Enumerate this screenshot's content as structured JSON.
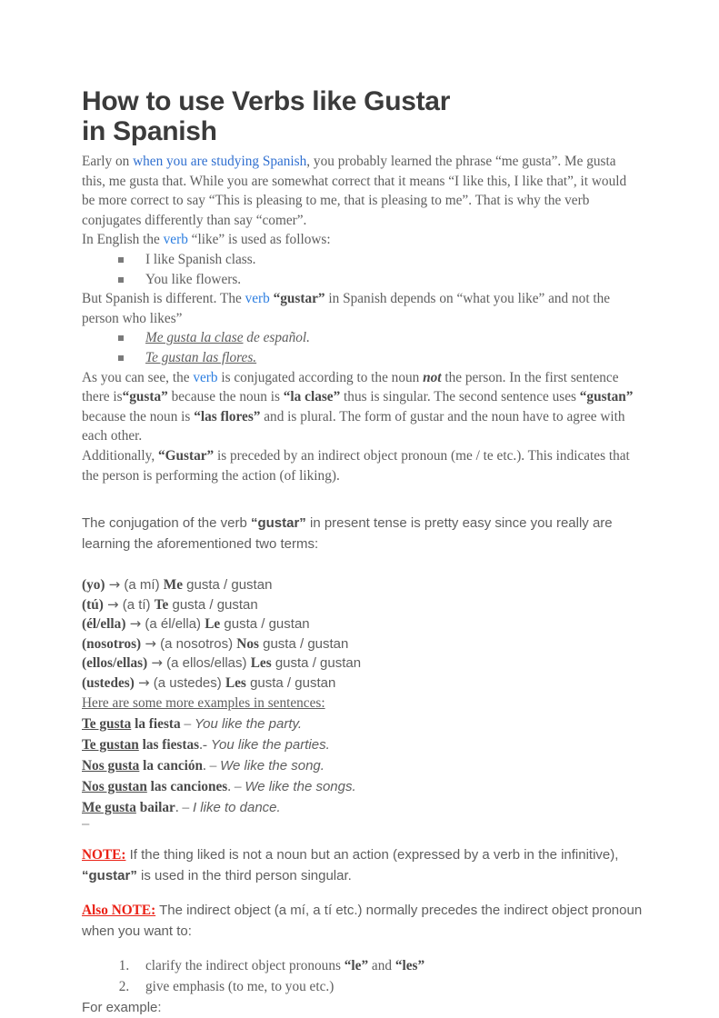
{
  "document": {
    "title_line_1": "How to use Verbs like Gustar",
    "title_line_2": "in Spanish"
  },
  "colors": {
    "link_blue": "#2f6fd0",
    "link_blue_bright": "#2b7de0",
    "note_red": "#ea2116",
    "body_text": "#5e5e5e",
    "heading_text": "#3b3b3b"
  },
  "intro": {
    "p1_a": "Early on ",
    "p1_link": "when you are studying Spanish",
    "p1_b": ", you probably learned the phrase “me gusta”.  Me gusta this, me gusta that. While you are somewhat correct that it means “I like this, I like that”, it would be more correct to say “This is pleasing to me, that is pleasing to me”.  That is why the verb conjugates differently than say “comer”.",
    "p2_a": "In English the ",
    "p2_link": "verb",
    "p2_b": " “like” is used as follows:"
  },
  "english_examples": [
    "I like Spanish class.",
    "You like flowers."
  ],
  "spanish_intro": {
    "a": "But Spanish is different. The ",
    "link": "verb",
    "b": " ",
    "bold": "“gustar”",
    "c": " in Spanish depends on “what you like” and not the person who likes”"
  },
  "spanish_examples": [
    {
      "underlined": "Me gusta la clase",
      "rest": " de español."
    },
    {
      "underlined": "Te gustan las flores.",
      "rest": ""
    }
  ],
  "explanation": {
    "a": "As you can see, the ",
    "link": "verb",
    "b": " is conjugated according to the noun ",
    "not": "not",
    "c": " the person.  In the first sentence there is",
    "gusta": "“gusta”",
    "d": " because the noun is ",
    "la_clase": "“la clase”",
    "e": " thus is singular.  The second sentence uses ",
    "gustan": "“gustan”",
    "f": " because the noun is ",
    "las_flores": "“las flores”",
    "g": " and is plural.  The form of gustar and the noun have to agree with each other.",
    "h": "Additionally, ",
    "gustar_cap": "“Gustar”",
    "i": " is preceded by an indirect object pronoun (me / te etc.). This indicates that the person is performing the action (of liking)."
  },
  "conjugation_intro": {
    "a": "The conjugation of the verb ",
    "bold": "“gustar”",
    "b": " in present tense is pretty easy since you really are learning the aforementioned two terms:"
  },
  "conjugation": [
    {
      "subject": "(yo)",
      "arrow": "→",
      "indirect": "(a mí)",
      "pronoun": "Me",
      "forms": "gusta / gustan"
    },
    {
      "subject": "(tú)",
      "arrow": "→",
      "indirect": "(a tí)",
      "pronoun": "Te",
      "forms": "gusta / gustan"
    },
    {
      "subject": "(él/ella)",
      "arrow": "→",
      "indirect": "(a él/ella)",
      "pronoun": "Le",
      "forms": "gusta / gustan"
    },
    {
      "subject": "(nosotros)",
      "arrow": "→",
      "indirect": "(a nosotros)",
      "pronoun": "Nos",
      "forms": "gusta / gustan"
    },
    {
      "subject": "(ellos/ellas)",
      "arrow": "→",
      "indirect": "(a ellos/ellas)",
      "pronoun": "Les",
      "forms": "gusta / gustan"
    },
    {
      "subject": "(ustedes)",
      "arrow": "→",
      "indirect": "(a ustedes)",
      "pronoun": "Les",
      "forms": "gusta / gustan"
    }
  ],
  "more_examples": {
    "heading": "Here are some more examples in sentences:",
    "items": [
      {
        "head": "Te gusta",
        "noun": " la fiesta",
        "sep": " – ",
        "english": "You like the party."
      },
      {
        "head": "Te gustan",
        "noun": " las fiestas",
        "sep": ".- ",
        "english": "You like the parties."
      },
      {
        "head": "Nos gusta",
        "noun": " la canción",
        "sep": ". – ",
        "english": "We like the song."
      },
      {
        "head": "Nos gustan",
        "noun": " las canciones",
        "sep": ". – ",
        "english": "We like the songs."
      },
      {
        "head": "Me gusta",
        "noun": " bailar",
        "sep": ". – ",
        "english": "I like to dance."
      }
    ]
  },
  "dash_mark": "–",
  "notes": {
    "note_tag": "NOTE:",
    "note_a": " If the thing liked is not a noun but an action (expressed by a verb in the infinitive), ",
    "note_bold": "“gustar”",
    "note_b": " is used in the third person singular.",
    "also_tag": "Also NOTE:",
    "also_text": " The indirect object (a mí, a tí etc.) normally precedes the indirect object pronoun when you want to:"
  },
  "want_to_list": [
    {
      "a": "clarify the indirect object pronouns ",
      "b1": "“le”",
      "c": " and ",
      "b2": "“les”",
      "d": ""
    },
    {
      "a": "give emphasis (to me, to you etc.)",
      "b1": "",
      "c": "",
      "b2": "",
      "d": ""
    }
  ],
  "closing": "For example:"
}
